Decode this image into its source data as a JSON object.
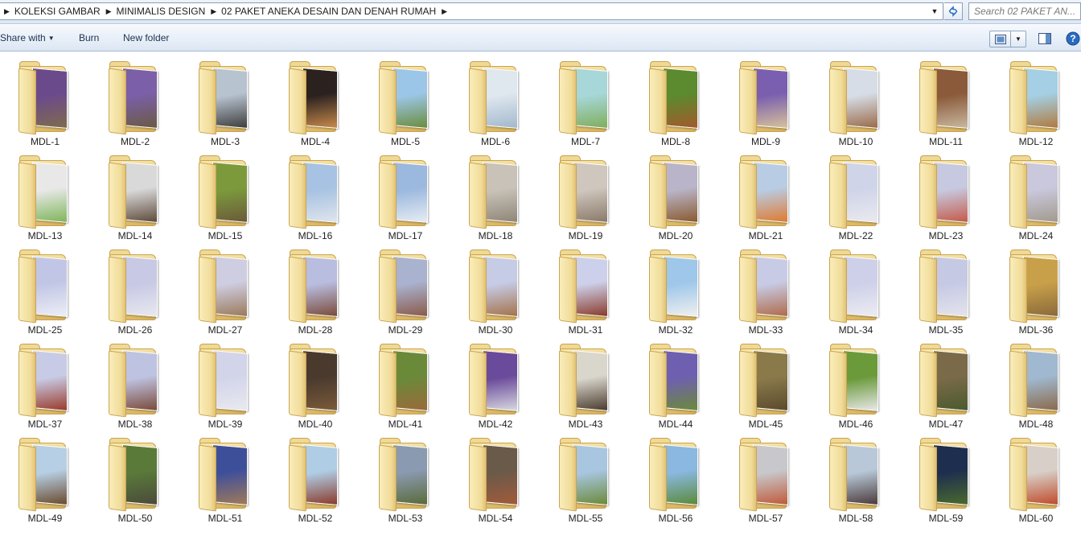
{
  "address": {
    "breadcrumbs": [
      "KOLEKSI GAMBAR",
      "MINIMALIS DESIGN",
      "02 PAKET ANEKA DESAIN DAN DENAH RUMAH"
    ],
    "search_placeholder": "Search 02 PAKET AN..."
  },
  "toolbar": {
    "share_label": "Share with",
    "burn_label": "Burn",
    "newfolder_label": "New folder"
  },
  "icons": {
    "refresh": "refresh-icon",
    "view": "change-view-icon",
    "preview": "preview-pane-icon",
    "help": "help-icon"
  },
  "colors": {
    "folder": "#ecd089",
    "accent": "#1e3250"
  },
  "folders": [
    {
      "name": "MDL-1",
      "c1": "#6b4a8c",
      "c2": "#7f6a4e"
    },
    {
      "name": "MDL-2",
      "c1": "#7b5fa8",
      "c2": "#6a5a44"
    },
    {
      "name": "MDL-3",
      "c1": "#b7c3cf",
      "c2": "#3d3d3d"
    },
    {
      "name": "MDL-4",
      "c1": "#2b2220",
      "c2": "#c98a4b"
    },
    {
      "name": "MDL-5",
      "c1": "#9cc6e8",
      "c2": "#6a8d3d"
    },
    {
      "name": "MDL-6",
      "c1": "#dfe7ef",
      "c2": "#a2b8cc"
    },
    {
      "name": "MDL-7",
      "c1": "#a7d7d9",
      "c2": "#7fae5b"
    },
    {
      "name": "MDL-8",
      "c1": "#5b8a2f",
      "c2": "#a25a2a"
    },
    {
      "name": "MDL-9",
      "c1": "#7a5fb0",
      "c2": "#d8c29a"
    },
    {
      "name": "MDL-10",
      "c1": "#d6dde6",
      "c2": "#9a6a4a"
    },
    {
      "name": "MDL-11",
      "c1": "#8a5a3a",
      "c2": "#c9b8a0"
    },
    {
      "name": "MDL-12",
      "c1": "#a4cfe4",
      "c2": "#b07a3e"
    },
    {
      "name": "MDL-13",
      "c1": "#e8e8e8",
      "c2": "#7fb65a"
    },
    {
      "name": "MDL-14",
      "c1": "#d9d9d9",
      "c2": "#5e4a3a"
    },
    {
      "name": "MDL-15",
      "c1": "#7c9a3c",
      "c2": "#6b5a3a"
    },
    {
      "name": "MDL-16",
      "c1": "#a7c2e2",
      "c2": "#dfe5ec"
    },
    {
      "name": "MDL-17",
      "c1": "#9bb8de",
      "c2": "#e6ecf3"
    },
    {
      "name": "MDL-18",
      "c1": "#c8c2b8",
      "c2": "#8f8678"
    },
    {
      "name": "MDL-19",
      "c1": "#cfc6bd",
      "c2": "#8a7a6a"
    },
    {
      "name": "MDL-20",
      "c1": "#b9b4c9",
      "c2": "#8a5a2e"
    },
    {
      "name": "MDL-21",
      "c1": "#b8cce4",
      "c2": "#e07a30"
    },
    {
      "name": "MDL-22",
      "c1": "#cfd4e8",
      "c2": "#e9e9ef"
    },
    {
      "name": "MDL-23",
      "c1": "#c6c9e0",
      "c2": "#c55a4a"
    },
    {
      "name": "MDL-24",
      "c1": "#c9c8dc",
      "c2": "#a29a8e"
    },
    {
      "name": "MDL-25",
      "c1": "#c2c6e6",
      "c2": "#eceef6"
    },
    {
      "name": "MDL-26",
      "c1": "#c7c9e5",
      "c2": "#e8e8ef"
    },
    {
      "name": "MDL-27",
      "c1": "#cfcde2",
      "c2": "#9a7a5a"
    },
    {
      "name": "MDL-28",
      "c1": "#b9bde0",
      "c2": "#7a4a3a"
    },
    {
      "name": "MDL-29",
      "c1": "#a9b2cf",
      "c2": "#8a5a4a"
    },
    {
      "name": "MDL-30",
      "c1": "#c6cbe6",
      "c2": "#a4724a"
    },
    {
      "name": "MDL-31",
      "c1": "#cdd0ea",
      "c2": "#8a3a2a"
    },
    {
      "name": "MDL-32",
      "c1": "#9ec7ea",
      "c2": "#f0f0f0"
    },
    {
      "name": "MDL-33",
      "c1": "#c8cbe6",
      "c2": "#b06a4a"
    },
    {
      "name": "MDL-34",
      "c1": "#cdd0e8",
      "c2": "#ececf2"
    },
    {
      "name": "MDL-35",
      "c1": "#c6c9e4",
      "c2": "#e4e4ec"
    },
    {
      "name": "MDL-36",
      "c1": "#c9a04a",
      "c2": "#8a6a3a"
    },
    {
      "name": "MDL-37",
      "c1": "#c8cbe6",
      "c2": "#9a3a2a"
    },
    {
      "name": "MDL-38",
      "c1": "#bfc3e2",
      "c2": "#7a4a3a"
    },
    {
      "name": "MDL-39",
      "c1": "#d2d4ea",
      "c2": "#e9e9ef"
    },
    {
      "name": "MDL-40",
      "c1": "#4a3a2e",
      "c2": "#7a5a3a"
    },
    {
      "name": "MDL-41",
      "c1": "#6a8a3a",
      "c2": "#9a6a3a"
    },
    {
      "name": "MDL-42",
      "c1": "#6a4a9a",
      "c2": "#d8d8e0"
    },
    {
      "name": "MDL-43",
      "c1": "#d9d6cc",
      "c2": "#4a3a2e"
    },
    {
      "name": "MDL-44",
      "c1": "#6f5fb0",
      "c2": "#6b8a3a"
    },
    {
      "name": "MDL-45",
      "c1": "#8a7a4a",
      "c2": "#5a4a2e"
    },
    {
      "name": "MDL-46",
      "c1": "#6a9a3a",
      "c2": "#e8e8e8"
    },
    {
      "name": "MDL-47",
      "c1": "#7a6a4a",
      "c2": "#4a5a2e"
    },
    {
      "name": "MDL-48",
      "c1": "#a0b8d0",
      "c2": "#8a6a4a"
    },
    {
      "name": "MDL-49",
      "c1": "#b7cfe4",
      "c2": "#6a4a2e"
    },
    {
      "name": "MDL-50",
      "c1": "#5a7a3a",
      "c2": "#4a4a3a"
    },
    {
      "name": "MDL-51",
      "c1": "#3e4f9a",
      "c2": "#a07a5a"
    },
    {
      "name": "MDL-52",
      "c1": "#b0cde6",
      "c2": "#8a3a2a"
    },
    {
      "name": "MDL-53",
      "c1": "#8a9ab0",
      "c2": "#5a6a3a"
    },
    {
      "name": "MDL-54",
      "c1": "#6a5a4a",
      "c2": "#a25a3a"
    },
    {
      "name": "MDL-55",
      "c1": "#a8c6e0",
      "c2": "#6a8a3a"
    },
    {
      "name": "MDL-56",
      "c1": "#8ab8e0",
      "c2": "#5a8a3a"
    },
    {
      "name": "MDL-57",
      "c1": "#c8c8cc",
      "c2": "#c05a3a"
    },
    {
      "name": "MDL-58",
      "c1": "#b8c8d8",
      "c2": "#4a3a3a"
    },
    {
      "name": "MDL-59",
      "c1": "#1e2e4e",
      "c2": "#4a6a2e"
    },
    {
      "name": "MDL-60",
      "c1": "#d8d0c8",
      "c2": "#c04a2a"
    }
  ]
}
